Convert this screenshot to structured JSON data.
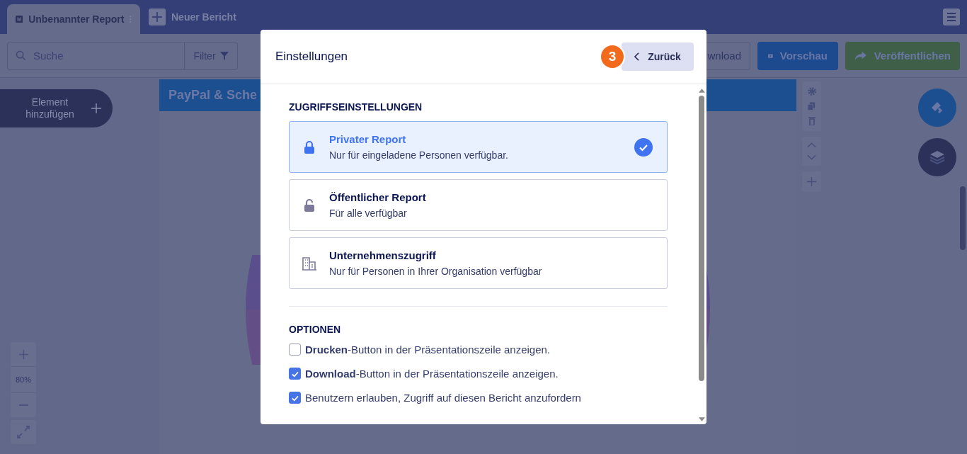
{
  "tabs": [
    {
      "label": "Unbenannter Report",
      "selected": true
    }
  ],
  "new_tab_button": "Neuer Bericht",
  "search": {
    "placeholder": "Suche"
  },
  "filter_button": "Filter",
  "toolbar_buttons": [
    {
      "kind": "download",
      "label": "wnload"
    },
    {
      "kind": "preview",
      "label": "Vorschau"
    },
    {
      "kind": "publish",
      "label": "Veröffentlichen"
    }
  ],
  "add_element_button": "Element hinzufügen",
  "zoom": {
    "value": "80%"
  },
  "report": {
    "title": "PayPal & Sche"
  },
  "dialog": {
    "title": "Einstellungen",
    "step_badge": "3",
    "back_button": "Zurück",
    "access_heading": "ZUGRIFFSEINSTELLUNGEN",
    "access_options": [
      {
        "kind": "private",
        "title": "Privater Report",
        "description": "Nur für eingeladene Personen verfügbar.",
        "selected": true
      },
      {
        "kind": "public",
        "title": "Öffentlicher Report",
        "description": "Für alle verfügbar",
        "selected": false
      },
      {
        "kind": "company",
        "title": "Unternehmenszugriff",
        "description": "Nur für Personen in Ihrer Organisation verfügbar",
        "selected": false
      }
    ],
    "options_heading": "OPTIONEN",
    "options": [
      {
        "label": "**Drucken**-Button in der Präsentationszeile anzeigen.",
        "checked": false
      },
      {
        "label": "**Download**-Button in der Präsentationszeile anzeigen.",
        "checked": true
      },
      {
        "label": "Benutzern erlauben, Zugriff auf diesen Bericht anzufordern",
        "checked": true
      }
    ]
  }
}
